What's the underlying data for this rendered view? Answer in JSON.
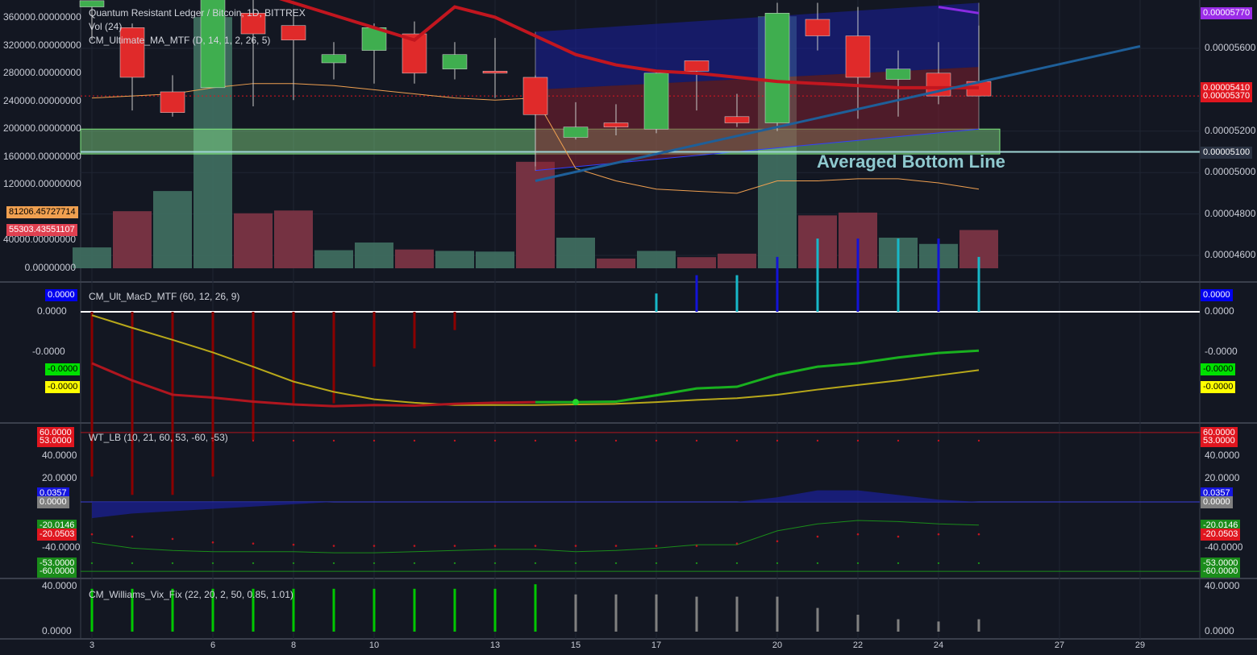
{
  "header": {
    "symbol_line": "Quantum Resistant Ledger / Bitcoin, 1D, BITTREX",
    "vol_line": "Vol (24)",
    "ma_line": "CM_Ultimate_MA_MTF (D, 14, 1, 2, 26, 5)"
  },
  "pane_titles": {
    "macd": "CM_Ult_MacD_MTF (60, 12, 26, 9)",
    "wt": "WT_LB (10, 21, 60, 53, -60, -53)",
    "vix": "CM_Williams_Vix_Fix (22, 20, 2, 50, 0.85, 1.01)"
  },
  "annotation": "Averaged Bottom Line",
  "colors": {
    "background": "#131722",
    "up": "#3fae4f",
    "down": "#e02a2a",
    "vol_up": "#3e6b5f",
    "vol_down": "#7a3444",
    "ma_red": "#c2161f",
    "purple": "#8a2be2",
    "trend_blue": "#1e5f99",
    "channel_blue": "#1a1f8c",
    "zone_green": "#90ee90",
    "averaged_line": "#9fd4d4"
  },
  "price_axis_right": {
    "ticks": [
      "0.00005600",
      "0.00005200",
      "0.00005000",
      "0.00004800",
      "0.00004600"
    ],
    "tick_values": [
      5.6e-05,
      5.2e-05,
      5e-05,
      4.8e-05,
      4.6e-05
    ],
    "badges": [
      {
        "text": "0.00005770",
        "value": 5.77e-05,
        "color": "#9b2de8"
      },
      {
        "text": "0.00005410",
        "value": 5.41e-05,
        "color": "#e0161f"
      },
      {
        "text": "0.00005370",
        "value": 5.37e-05,
        "color": "#e0161f"
      },
      {
        "text": "0.00005100",
        "value": 5.1e-05,
        "color": "#2a3242"
      }
    ]
  },
  "volume_axis_left": {
    "ticks": [
      "360000.00000000",
      "320000.00000000",
      "280000.00000000",
      "240000.00000000",
      "200000.00000000",
      "160000.00000000",
      "120000.00000000",
      "40000.00000000",
      "0.00000000"
    ],
    "tick_values": [
      360000,
      320000,
      280000,
      240000,
      200000,
      160000,
      120000,
      40000,
      0
    ],
    "badges": [
      {
        "text": "81206.45727714",
        "value": 81206.45727714,
        "color": "#f0a050",
        "text_color": "#000000"
      },
      {
        "text": "55303.43551107",
        "value": 55303.43551107,
        "color": "#e04050",
        "text_color": "#ffffff"
      }
    ]
  },
  "macd_axis": {
    "ticks": [
      "0.0000",
      "-0.0000"
    ],
    "badges": [
      {
        "text": "0.0000",
        "color": "#0000ee"
      },
      {
        "text": "-0.0000",
        "color": "#00e000"
      },
      {
        "text": "-0.0000",
        "color": "#ffff00"
      }
    ]
  },
  "wt_axis": {
    "ticks": [
      "40.0000",
      "20.0000",
      "-40.0000"
    ],
    "tick_values": [
      40,
      20,
      -40
    ],
    "badges": [
      {
        "text": "60.0000",
        "value": 60,
        "color": "#e0161f"
      },
      {
        "text": "53.0000",
        "value": 53,
        "color": "#e0161f"
      },
      {
        "text": "0.0357",
        "value": 8,
        "color": "#1616e0"
      },
      {
        "text": "0.0000",
        "value": 0,
        "color": "#808080"
      },
      {
        "text": "-20.0146",
        "value": -20.0146,
        "color": "#1a8c1a"
      },
      {
        "text": "-20.0503",
        "value": -28,
        "color": "#e0161f"
      },
      {
        "text": "-53.0000",
        "value": -53,
        "color": "#1a8c1a"
      },
      {
        "text": "-60.0000",
        "value": -60,
        "color": "#1a8c1a"
      }
    ]
  },
  "vix_axis": {
    "ticks": [
      "40.0000",
      "0.0000"
    ],
    "tick_values": [
      40,
      0
    ]
  },
  "time_axis": {
    "labels": [
      {
        "text": "3",
        "index": 0
      },
      {
        "text": "6",
        "index": 3
      },
      {
        "text": "8",
        "index": 5
      },
      {
        "text": "10",
        "index": 7
      },
      {
        "text": "13",
        "index": 10
      },
      {
        "text": "15",
        "index": 12
      },
      {
        "text": "17",
        "index": 14
      },
      {
        "text": "20",
        "index": 17
      },
      {
        "text": "22",
        "index": 19
      },
      {
        "text": "24",
        "index": 21
      },
      {
        "text": "27",
        "index": 24
      },
      {
        "text": "29",
        "index": 26
      }
    ]
  },
  "chart_data": [
    {
      "type": "candlestick",
      "title": "Quantum Resistant Ledger / Bitcoin, 1D, BITTREX",
      "unit": "BTC",
      "candles": [
        {
          "o": 5.8e-05,
          "h": 5.83e-05,
          "l": 5.64e-05,
          "c": 5.83e-05
        },
        {
          "o": 5.7e-05,
          "h": 5.72e-05,
          "l": 5.3e-05,
          "c": 5.46e-05
        },
        {
          "o": 5.39e-05,
          "h": 5.47e-05,
          "l": 5.27e-05,
          "c": 5.29e-05
        },
        {
          "o": 5.41e-05,
          "h": 5.9e-05,
          "l": 5.41e-05,
          "c": 5.9e-05
        },
        {
          "o": 5.77e-05,
          "h": 5.9e-05,
          "l": 5.32e-05,
          "c": 5.67e-05
        },
        {
          "o": 5.71e-05,
          "h": 5.79e-05,
          "l": 5.35e-05,
          "c": 5.64e-05
        },
        {
          "o": 5.53e-05,
          "h": 5.63e-05,
          "l": 5.45e-05,
          "c": 5.57e-05
        },
        {
          "o": 5.59e-05,
          "h": 5.72e-05,
          "l": 5.43e-05,
          "c": 5.7e-05
        },
        {
          "o": 5.67e-05,
          "h": 5.73e-05,
          "l": 5.43e-05,
          "c": 5.48e-05
        },
        {
          "o": 5.5e-05,
          "h": 5.63e-05,
          "l": 5.45e-05,
          "c": 5.57e-05
        },
        {
          "o": 5.49e-05,
          "h": 5.65e-05,
          "l": 5.36e-05,
          "c": 5.48e-05
        },
        {
          "o": 5.46e-05,
          "h": 5.47e-05,
          "l": 5.03e-05,
          "c": 5.28e-05
        },
        {
          "o": 5.17e-05,
          "h": 5.34e-05,
          "l": 5.16e-05,
          "c": 5.22e-05
        },
        {
          "o": 5.24e-05,
          "h": 5.33e-05,
          "l": 5.18e-05,
          "c": 5.22e-05
        },
        {
          "o": 5.21e-05,
          "h": 5.49e-05,
          "l": 5.19e-05,
          "c": 5.48e-05
        },
        {
          "o": 5.54e-05,
          "h": 5.54e-05,
          "l": 5.3e-05,
          "c": 5.49e-05
        },
        {
          "o": 5.27e-05,
          "h": 5.38e-05,
          "l": 5.22e-05,
          "c": 5.24e-05
        },
        {
          "o": 5.24e-05,
          "h": 5.82e-05,
          "l": 5.2e-05,
          "c": 5.77e-05
        },
        {
          "o": 5.74e-05,
          "h": 5.82e-05,
          "l": 5.59e-05,
          "c": 5.66e-05
        },
        {
          "o": 5.66e-05,
          "h": 5.8e-05,
          "l": 5.26e-05,
          "c": 5.46e-05
        },
        {
          "o": 5.45e-05,
          "h": 5.59e-05,
          "l": 5.27e-05,
          "c": 5.5e-05
        },
        {
          "o": 5.48e-05,
          "h": 5.63e-05,
          "l": 5.33e-05,
          "c": 5.37e-05
        },
        {
          "o": 5.44e-05,
          "h": 5.71e-05,
          "l": 5.37e-05,
          "c": 5.37e-05
        }
      ],
      "ma_line": [
        6.12e-05,
        6.06e-05,
        6e-05,
        5.94e-05,
        5.88e-05,
        5.82e-05,
        5.76e-05,
        5.7e-05,
        5.64e-05,
        5.8e-05,
        5.75e-05,
        5.66e-05,
        5.57e-05,
        5.52e-05,
        5.49e-05,
        5.48e-05,
        5.46e-05,
        5.44e-05,
        5.43e-05,
        5.42e-05,
        5.41e-05,
        5.41e-05,
        5.41e-05
      ],
      "purple_line": [
        5.8e-05,
        5.77e-05
      ],
      "thin_ma": [
        5.36e-05,
        5.37e-05,
        5.38e-05,
        5.41e-05,
        5.43e-05,
        5.43e-05,
        5.42e-05,
        5.4e-05,
        5.38e-05,
        5.36e-05,
        5.35e-05,
        5.36e-05,
        5.02e-05,
        4.96e-05,
        4.92e-05,
        4.91e-05,
        4.9e-05,
        4.96e-05,
        4.96e-05,
        4.97e-05,
        4.97e-05,
        4.95e-05,
        4.92e-05
      ],
      "zone": {
        "low": 5.09e-05,
        "high": 5.21e-05,
        "from_index": 0,
        "to_index": 23
      },
      "averaged_bottom_line": 5.1e-05,
      "trend_line": {
        "start_index": 11,
        "start": 4.96e-05,
        "end_index": 26,
        "end": 5.61e-05
      },
      "channel": {
        "start_index": 11,
        "end_index": 22,
        "top_start": 5.68e-05,
        "top_end": 5.82e-05,
        "mid_end": 5.51e-05,
        "bottom_start": 5.01e-05,
        "bottom_end": 5.21e-05
      }
    },
    {
      "type": "bar",
      "title": "Vol (24)",
      "values": [
        30000,
        82000,
        111000,
        361000,
        79000,
        83000,
        26000,
        37000,
        27000,
        25000,
        24000,
        153000,
        44000,
        14000,
        25000,
        16000,
        21000,
        362000,
        76000,
        80000,
        44000,
        35000,
        55000
      ],
      "up": [
        true,
        false,
        true,
        true,
        false,
        false,
        true,
        true,
        false,
        true,
        true,
        false,
        true,
        false,
        true,
        false,
        false,
        true,
        false,
        false,
        true,
        true,
        false
      ],
      "ylim": [
        0,
        380000
      ]
    },
    {
      "type": "line",
      "title": "CM_Ult_MacD_MTF (60, 12, 26, 9)",
      "histogram": [
        -9,
        -10,
        -10,
        -9,
        -7,
        -5,
        -5,
        -3,
        -2,
        -1,
        0,
        0,
        0,
        0,
        1,
        2,
        2,
        3,
        4,
        4,
        4,
        4,
        3
      ],
      "macd_line": [
        -9,
        -12,
        -14.5,
        -15,
        -15.7,
        -16.2,
        -16.5,
        -16.3,
        -16.4,
        -16.1,
        -15.9,
        -15.8,
        -15.8,
        -15.7,
        -14.6,
        -13.4,
        -13.1,
        -11,
        -9.6,
        -9,
        -8,
        -7.2,
        -6.8
      ],
      "signal_line": [
        -0.6,
        -2.8,
        -4.9,
        -7.1,
        -9.6,
        -12.2,
        -14.0,
        -15.3,
        -15.9,
        -16.3,
        -16.3,
        -16.3,
        -16.2,
        -16.1,
        -15.8,
        -15.4,
        -15.1,
        -14.5,
        -13.6,
        -12.8,
        -12.0,
        -11.1,
        -10.2
      ],
      "ylim": [
        -18,
        3
      ]
    },
    {
      "type": "line",
      "title": "WT_LB (10, 21, 60, 53, -60, -53)",
      "wt1": [
        -35,
        -40,
        -42,
        -43,
        -43,
        -43,
        -44,
        -44,
        -43,
        -42,
        -41,
        -41,
        -43,
        -42,
        -40,
        -37,
        -37,
        -25,
        -19,
        -16,
        -17,
        -19,
        -20
      ],
      "wt2": [
        -28,
        -30,
        -32,
        -35,
        -36,
        -37,
        -38,
        -38,
        -38,
        -38,
        -38,
        -38,
        -38,
        -38,
        -38,
        -38,
        -36,
        -34,
        -30,
        -28,
        -30,
        -28,
        -28
      ],
      "histogram": [
        -7,
        -5,
        -4,
        -3,
        -2,
        -1,
        0,
        0,
        0,
        0,
        0,
        0,
        0,
        0,
        0,
        0,
        0,
        2,
        5,
        5,
        3,
        1,
        0
      ],
      "ylim": [
        -62,
        62
      ]
    },
    {
      "type": "bar",
      "title": "CM_Williams_Vix_Fix (22, 20, 2, 50, 0.85, 1.01)",
      "values": [
        38,
        38,
        38,
        38,
        38,
        38,
        38,
        38,
        38,
        38,
        38,
        42,
        33,
        33,
        33,
        31,
        31,
        31,
        21,
        15,
        11,
        9,
        11
      ],
      "highlight": [
        true,
        true,
        true,
        true,
        true,
        true,
        true,
        true,
        true,
        true,
        true,
        true,
        false,
        false,
        false,
        false,
        false,
        false,
        false,
        false,
        false,
        false,
        false
      ],
      "ylim": [
        0,
        45
      ]
    }
  ]
}
